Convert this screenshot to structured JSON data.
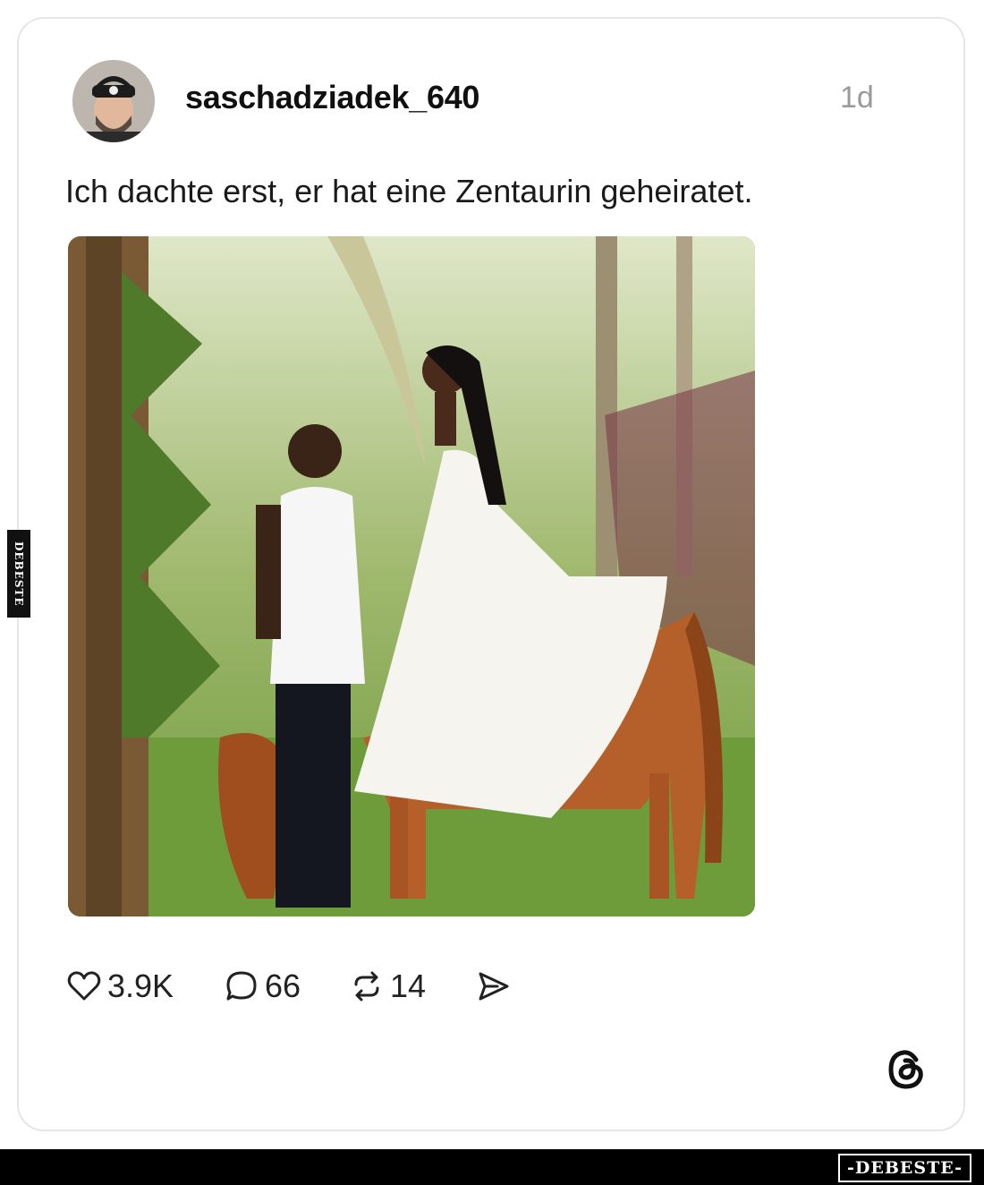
{
  "post": {
    "username": "saschadziadek_640",
    "time_ago": "1d",
    "text": "Ich dachte erst, er hat eine Zentaurin geheiratet."
  },
  "actions": {
    "likes": "3.9K",
    "comments": "66",
    "reposts": "14"
  },
  "icons": {
    "like": "heart-icon",
    "comment": "comment-bubble-icon",
    "repost": "repost-icon",
    "share": "send-icon",
    "brand": "threads-logo-icon"
  },
  "watermark": {
    "side": "DEBESTE",
    "footer": "-DEBESTE-"
  },
  "colors": {
    "text": "#101010",
    "muted": "#9a9a9a",
    "card_border": "#e6e6e6",
    "footer_bg": "#000000"
  }
}
